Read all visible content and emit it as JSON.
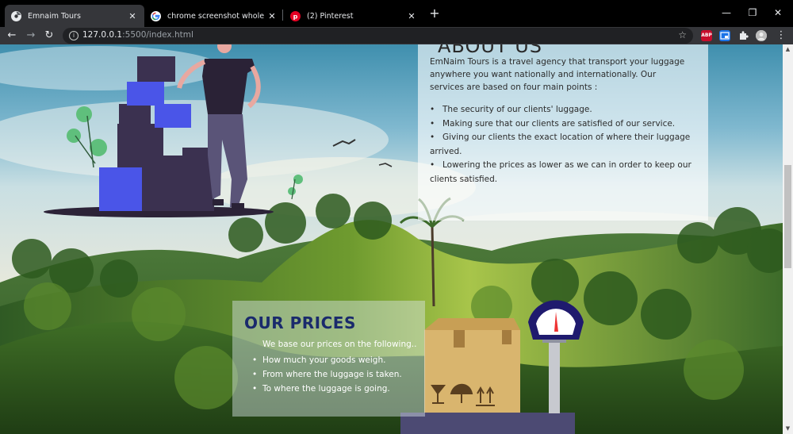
{
  "browser": {
    "tabs": [
      {
        "title": "Emnaim Tours",
        "favicon": "chrome-web-icon",
        "active": true
      },
      {
        "title": "chrome screenshot whole page s",
        "favicon": "google-icon",
        "active": false
      },
      {
        "title": "(2) Pinterest",
        "favicon": "pinterest-icon",
        "active": false
      }
    ],
    "new_tab": "+",
    "window_controls": {
      "minimize": "—",
      "restore": "❐",
      "close": "✕"
    },
    "url_host": "127.0.0.1",
    "url_path": ":5500/index.html",
    "extensions": [
      {
        "name": "adblock-plus-icon",
        "label": "ABP",
        "color": "#c70d2c"
      },
      {
        "name": "cast-icon",
        "label": "",
        "color": "#1a73e8"
      },
      {
        "name": "puzzle-extensions-icon",
        "label": "",
        "color": "#35363a"
      }
    ]
  },
  "about": {
    "heading": "ABOUT US",
    "intro": "EmNaim Tours is a travel agency that transport your luggage anywhere you want nationally and internationally. Our services are based on four main points :",
    "points": [
      "The security of our clients' luggage.",
      "Making sure that our clients are satisfied of our service.",
      "Giving our clients the exact location of where their luggage arrived.",
      "Lowering the prices as lower as we can in order to keep our clients satisfied."
    ]
  },
  "prices": {
    "title": "OUR PRICES",
    "intro": "We base our prices on the following..",
    "points": [
      "How much your goods weigh.",
      "From where the luggage is taken.",
      "To where the luggage is going."
    ]
  },
  "colors": {
    "accent_navy": "#1a2a6c",
    "box_blue": "#4a55e8",
    "box_dark": "#3b3150",
    "cardboard": "#d9b56e",
    "scale_dial": "#1f1a6e"
  }
}
